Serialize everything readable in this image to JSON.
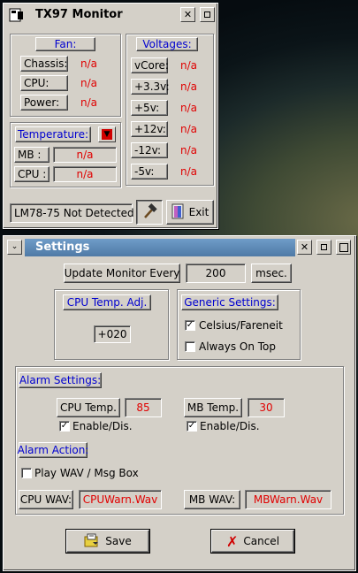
{
  "monitor": {
    "title": "TX97 Monitor",
    "fan": {
      "header": "Fan:",
      "rows": [
        {
          "label": "Chassis:",
          "value": "n/a"
        },
        {
          "label": "CPU:",
          "value": "n/a"
        },
        {
          "label": "Power:",
          "value": "n/a"
        }
      ]
    },
    "voltages": {
      "header": "Voltages:",
      "rows": [
        {
          "label": "vCore:",
          "value": "n/a"
        },
        {
          "label": "+3.3v:",
          "value": "n/a"
        },
        {
          "label": "+5v:",
          "value": "n/a"
        },
        {
          "label": "+12v:",
          "value": "n/a"
        },
        {
          "label": "-12v:",
          "value": "n/a"
        },
        {
          "label": "-5v:",
          "value": "n/a"
        }
      ]
    },
    "temperature": {
      "header": "Temperature:",
      "rows": [
        {
          "label": "MB :",
          "value": "n/a"
        },
        {
          "label": "CPU :",
          "value": "n/a"
        }
      ]
    },
    "status": "LM78-75 Not Detected",
    "exit_label": "Exit"
  },
  "settings": {
    "title": "Settings",
    "update_label": "Update Monitor Every",
    "update_value": "200",
    "update_unit": "msec.",
    "cpu_adj_label": "CPU Temp. Adj.",
    "cpu_adj_value": "+020",
    "generic_label": "Generic Settings:",
    "celsius_label": "Celsius/Fareneit",
    "celsius_checked": true,
    "ontop_label": "Always On Top",
    "ontop_checked": false,
    "alarm_settings_label": "Alarm Settings:",
    "cpu_temp_label": "CPU Temp.",
    "cpu_temp_value": "85",
    "cpu_enable_label": "Enable/Dis.",
    "cpu_enable_checked": true,
    "mb_temp_label": "MB Temp.",
    "mb_temp_value": "30",
    "mb_enable_label": "Enable/Dis.",
    "mb_enable_checked": true,
    "alarm_action_label": "Alarm Action:",
    "playwav_label": "Play WAV / Msg Box",
    "playwav_checked": false,
    "cpu_wav_label": "CPU WAV:",
    "cpu_wav_value": "CPUWarn.Wav",
    "mb_wav_label": "MB WAV:",
    "mb_wav_value": "MBWarn.Wav",
    "save_label": "Save",
    "cancel_label": "Cancel"
  },
  "colors": {
    "accent_text": "#0000d0",
    "value_red": "#e00000",
    "titlebar_active": "#5e8ab6",
    "window_bg": "#d4d0c8"
  }
}
